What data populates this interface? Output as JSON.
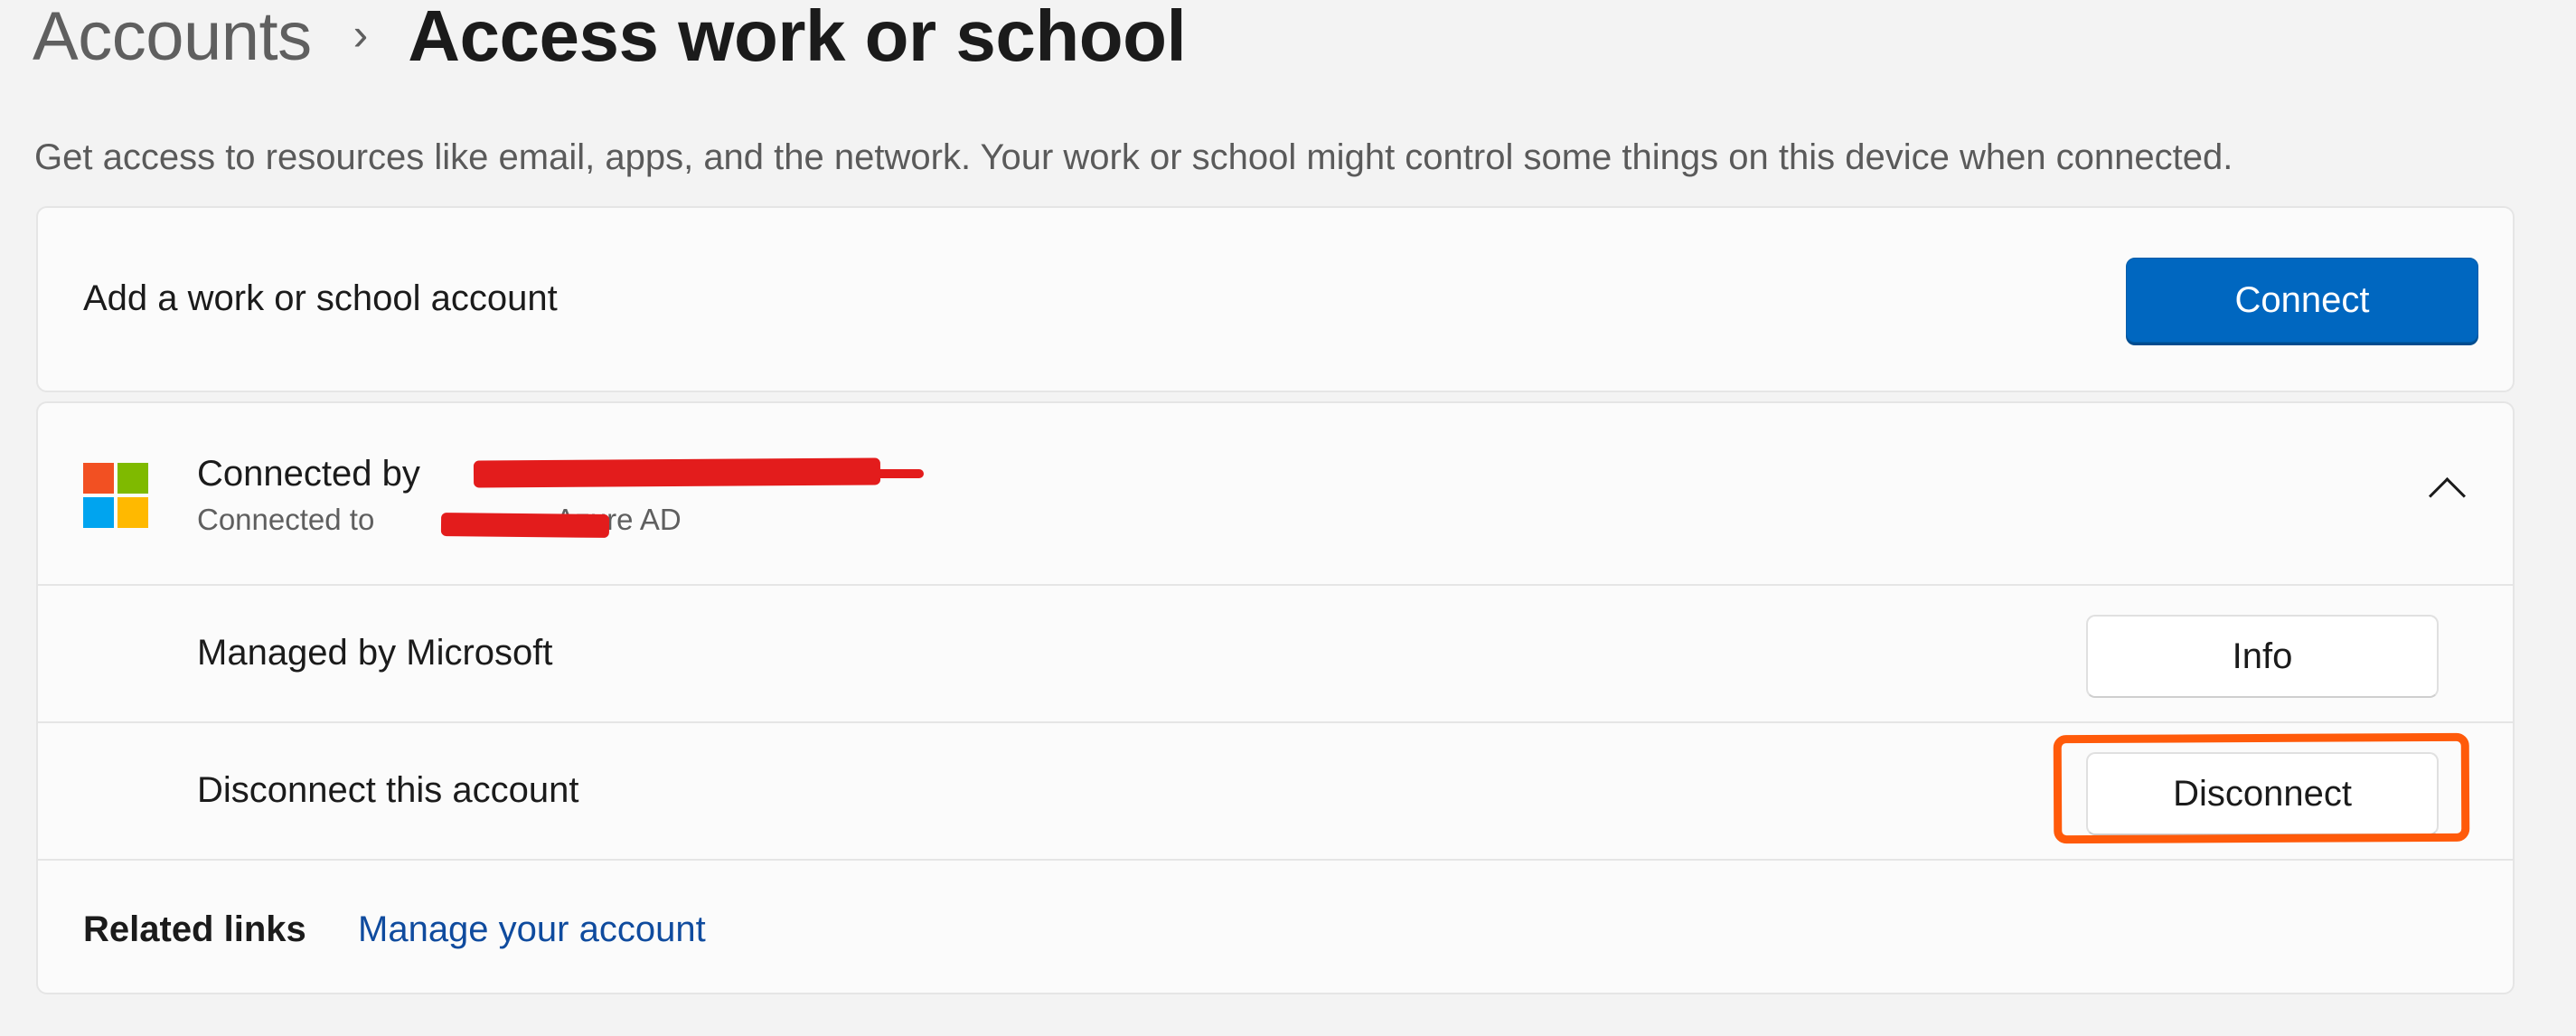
{
  "breadcrumb": {
    "parent": "Accounts",
    "separator": "›",
    "current": "Access work or school"
  },
  "description": "Get access to resources like email, apps, and the network. Your work or school might control some things on this device when connected.",
  "add_account": {
    "label": "Add a work or school account",
    "button_label": "Connect",
    "button_color": "#0067c0"
  },
  "account": {
    "icon": "microsoft-logo-icon",
    "title_prefix": "Connected by",
    "subtitle_prefix": "Connected to",
    "subtitle_suffix": "Azure AD",
    "expanded": true,
    "managed": {
      "label": "Managed by Microsoft",
      "button_label": "Info"
    },
    "disconnect": {
      "label": "Disconnect this account",
      "button_label": "Disconnect",
      "highlight_color": "#ff5a0a"
    }
  },
  "related": {
    "label": "Related links",
    "link_text": "Manage your account"
  },
  "redaction_color": "#e31c1c"
}
